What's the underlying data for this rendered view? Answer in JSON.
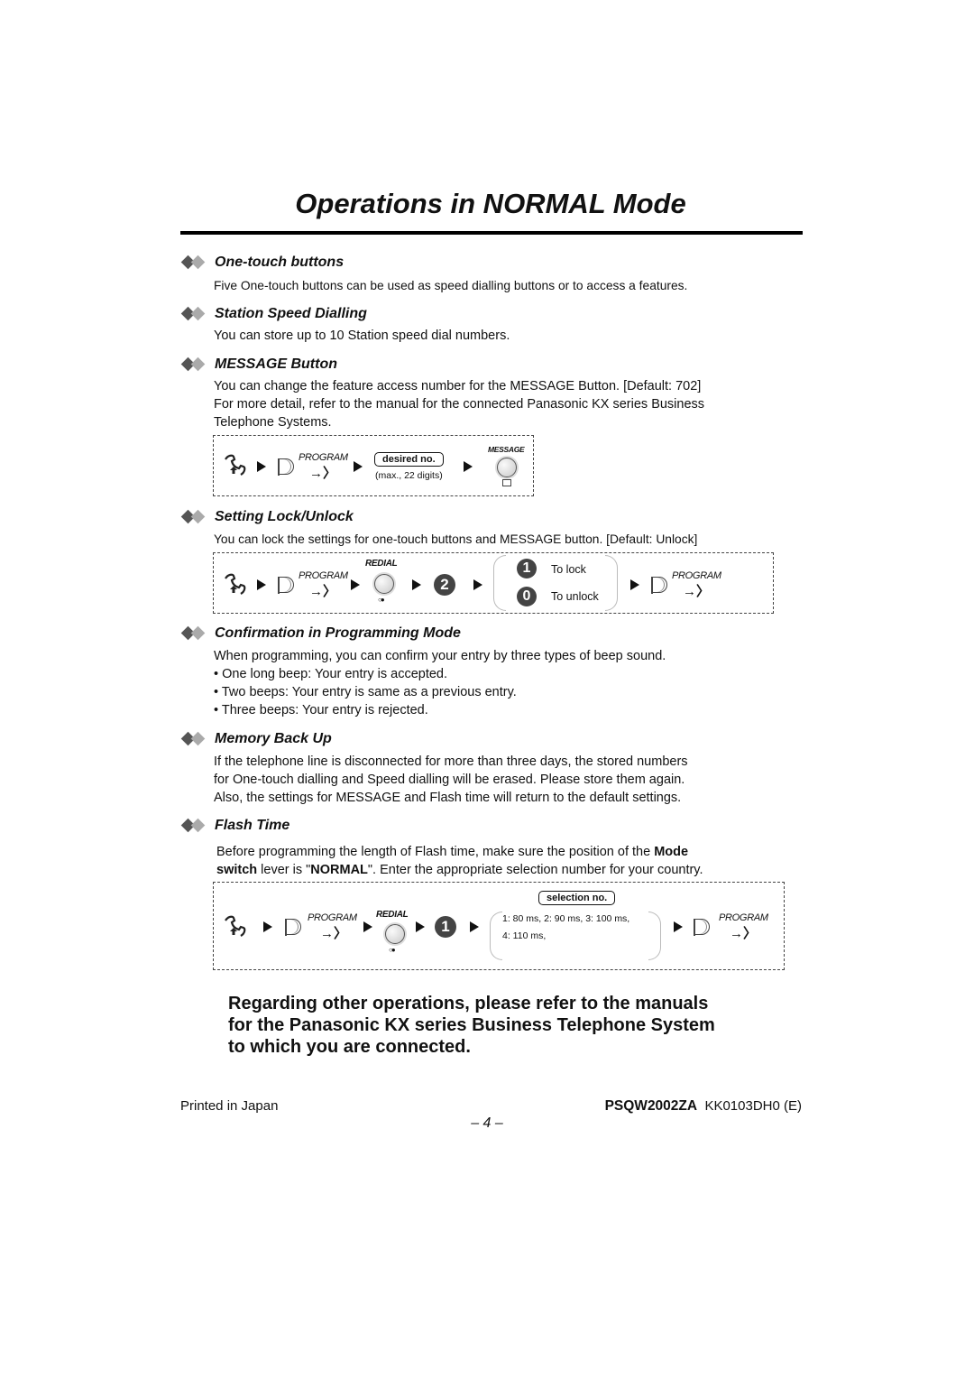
{
  "page": {
    "title": "Operations in NORMAL Mode"
  },
  "sections": [
    {
      "title": "One-touch buttons",
      "body": [
        "Five One-touch buttons can be used as speed dialling buttons or to access a features."
      ]
    },
    {
      "title": "Station Speed Dialling",
      "body": [
        "You can store up to 10 Station speed dial numbers."
      ]
    },
    {
      "title": "MESSAGE Button",
      "body": [
        "You can change the feature access number for the MESSAGE Button. [Default: 702]",
        "For more detail, refer to the manual for the connected Panasonic KX series Business",
        "Telephone Systems."
      ]
    },
    {
      "title": "Setting Lock/Unlock",
      "body": [
        "You can lock the settings for one-touch buttons and MESSAGE button. [Default: Unlock]"
      ]
    },
    {
      "title": "Confirmation in Programming Mode",
      "body": [
        "When programming, you can confirm your entry by three types of beep sound.",
        "• One long beep: Your entry is accepted.",
        "• Two beeps: Your entry is same as a previous entry.",
        "• Three beeps: Your entry is rejected."
      ]
    },
    {
      "title": "Memory Back Up",
      "body": [
        "If the telephone line is disconnected for more than three days, the stored numbers",
        "for One-touch dialling and Speed dialling will be erased.  Please store them again.",
        "Also, the settings for MESSAGE and Flash time will return to the default settings."
      ]
    },
    {
      "title": "Flash Time",
      "body_rich": {
        "line1_pre": "Before programming the length of Flash time, make sure the position of the ",
        "line1_bold": "Mode",
        "line2_bold1": "switch",
        "line2_mid": " lever is \"",
        "line2_bold2": "NORMAL",
        "line2_post": "\".  Enter the appropriate selection number for your country."
      }
    }
  ],
  "flows": {
    "message": {
      "program_label": "PROGRAM",
      "input_label": "desired no.",
      "input_hint": "(max., 22 digits)",
      "button_label": "MESSAGE"
    },
    "lock": {
      "program_label": "PROGRAM",
      "redial_label": "REDIAL",
      "digit": "2",
      "options": [
        {
          "digit": "1",
          "label": "To lock"
        },
        {
          "digit": "0",
          "label": "To unlock"
        }
      ],
      "end_program_label": "PROGRAM"
    },
    "flash": {
      "program_label": "PROGRAM",
      "redial_label": "REDIAL",
      "digit": "1",
      "selection_label": "selection no.",
      "options_line1": "1: 80 ms, 2: 90 ms, 3: 100 ms,",
      "options_line2": "4: 110 ms,",
      "end_program_label": "PROGRAM"
    }
  },
  "icons": {
    "enter": "→〉",
    "dots": "○●"
  },
  "closing": [
    "Regarding other operations, please refer to the manuals",
    "for the Panasonic KX series Business Telephone System",
    "to which you are connected."
  ],
  "footer": {
    "left": "Printed in Japan",
    "model": "PSQW2002ZA",
    "code": "KK0103DH0 (E)",
    "page_number": "– 4 –"
  }
}
